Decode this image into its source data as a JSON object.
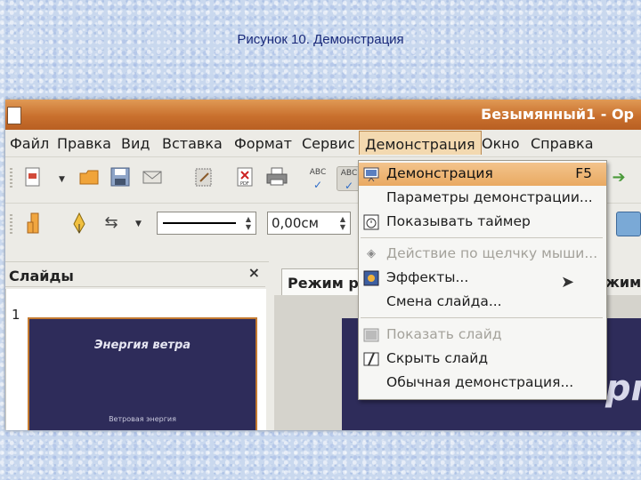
{
  "caption": "Рисунок 10. Демонстрация",
  "window": {
    "title": "Безымянный1 - Op"
  },
  "menubar": [
    "Файл",
    "Правка",
    "Вид",
    "Вставка",
    "Формат",
    "Сервис",
    "Демонстрация",
    "Окно",
    "Справка"
  ],
  "toolbar": {
    "line_width_value": "0,00см"
  },
  "slides_panel": {
    "title": "Слайды",
    "close_glyph": "×",
    "slide_number": "1",
    "thumb_title": "Энергия ветра",
    "thumb_subtitle": "Ветровая энергия"
  },
  "editor": {
    "tab_label": "Режим ри",
    "tab2_label": "жим",
    "slide_text": "рг"
  },
  "dropdown": {
    "items": [
      {
        "label": "Демонстрация",
        "shortcut": "F5",
        "icon": "presentation-icon",
        "state": "highlighted"
      },
      {
        "label": "Параметры демонстрации...",
        "shortcut": "",
        "icon": "",
        "state": "enabled"
      },
      {
        "label": "Показывать таймер",
        "shortcut": "",
        "icon": "timer-icon",
        "state": "enabled"
      },
      {
        "label": "Действие по щелчку мыши...",
        "shortcut": "",
        "icon": "interaction-icon",
        "state": "disabled"
      },
      {
        "label": "Эффекты...",
        "shortcut": "",
        "icon": "effects-icon",
        "state": "enabled"
      },
      {
        "label": "Смена слайда...",
        "shortcut": "",
        "icon": "",
        "state": "enabled"
      },
      {
        "label": "Показать слайд",
        "shortcut": "",
        "icon": "show-slide-icon",
        "state": "disabled"
      },
      {
        "label": "Скрыть слайд",
        "shortcut": "",
        "icon": "hide-slide-icon",
        "state": "enabled"
      },
      {
        "label": "Обычная демонстрация...",
        "shortcut": "",
        "icon": "",
        "state": "enabled"
      }
    ]
  },
  "colors": {
    "titlebar": "#c9702e",
    "menu_highlight": "#e9a962",
    "slide_background": "#2e2c5a"
  }
}
